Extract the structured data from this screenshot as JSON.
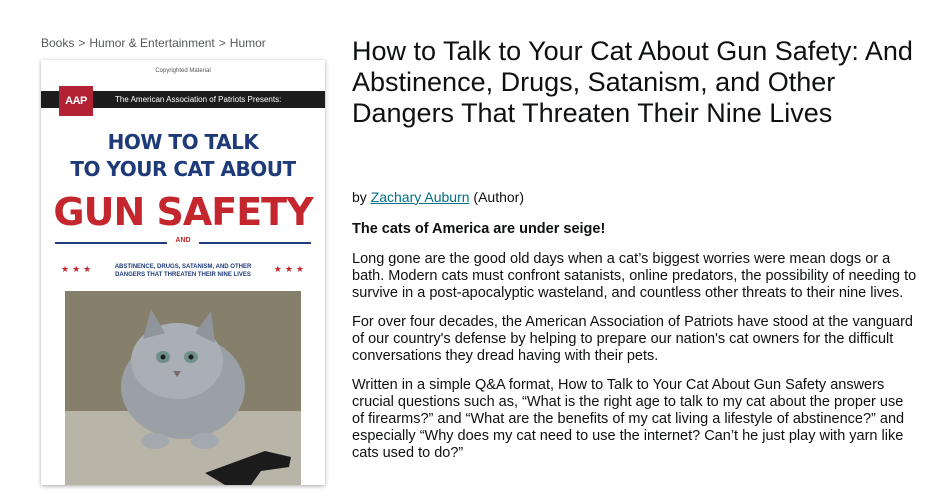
{
  "breadcrumb": {
    "items": [
      "Books",
      "Humor & Entertainment",
      "Humor"
    ],
    "separator": ">"
  },
  "cover": {
    "copyright": "Copyrighted Material",
    "logo": "AAP",
    "presenter": "The American Association of Patriots Presents:",
    "line1": "HOW TO TALK",
    "line2": "TO YOUR CAT ABOUT",
    "big": "GUN SAFETY",
    "and": "AND",
    "sub_line1": "ABSTINENCE, DRUGS, SATANISM, AND OTHER",
    "sub_line2": "DANGERS THAT THREATEN THEIR NINE LIVES",
    "stars": "★★★",
    "colors": {
      "navy": "#1e3a78",
      "red": "#c4262e",
      "band": "#1c1c1c"
    }
  },
  "product": {
    "title": "How to Talk to Your Cat About Gun Safety: And Abstinence, Drugs, Satanism, and Other Dangers That Threaten Their Nine Lives",
    "by": "by",
    "author": "Zachary Auburn",
    "role": "(Author)",
    "colors": {
      "link": "#007185"
    }
  },
  "description": {
    "lead": "The cats of America are under seige!",
    "paragraphs": [
      "Long gone are the good old days when a cat’s biggest worries were mean dogs or a bath. Modern cats must confront satanists, online predators, the possibility of needing to survive in a post-apocalyptic wasteland, and countless other threats to their nine lives.",
      "For over four decades, the American Association of Patriots have stood at the vanguard of our country's defense by helping to prepare our nation's cat owners for the difficult conversations they dread having with their pets.",
      "Written in a simple Q&A format, How to Talk to Your Cat About Gun Safety answers crucial questions such as, “What is the right age to talk to my cat about the proper use of firearms?” and “What are the benefits of my cat living a lifestyle of abstinence?” and especially “Why does my cat need to use the internet? Can’t he just play with yarn like cats used to do?”"
    ]
  }
}
